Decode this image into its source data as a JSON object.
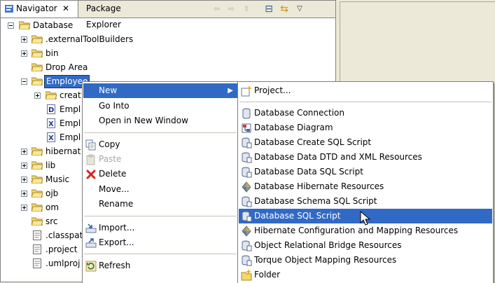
{
  "tabs": {
    "navigator": "Navigator",
    "navigator_close": "✕",
    "package_explorer": "Package Explorer"
  },
  "toolbar": {
    "back": "⇦",
    "forward": "⇨",
    "up": "⇧",
    "collapse": "⊟",
    "link": "⇆",
    "menu": "▽"
  },
  "tree": {
    "root": "Database",
    "items": [
      ".externalToolBuilders",
      "bin",
      "Drop Area",
      "Employee",
      "creat",
      "Empl",
      "Empl",
      "Empl",
      "hibernat",
      "lib",
      "Music",
      "ojb",
      "om",
      "src",
      ".classpat",
      ".project",
      ".umlproj"
    ]
  },
  "context_menu": {
    "new": "New",
    "go_into": "Go Into",
    "open_in_new_window": "Open in New Window",
    "copy": "Copy",
    "paste": "Paste",
    "delete": "Delete",
    "move": "Move...",
    "rename": "Rename",
    "import": "Import...",
    "export": "Export...",
    "refresh": "Refresh",
    "submenu_arrow": "▶"
  },
  "new_submenu": {
    "project": "Project...",
    "items": [
      "Database Connection",
      "Database Diagram",
      "Database Create SQL Script",
      "Database Data DTD and XML Resources",
      "Database Data SQL Script",
      "Database Hibernate Resources",
      "Database Schema SQL Script",
      "Database SQL Script",
      "Hibernate Configuration and Mapping Resources",
      "Object Relational Bridge Resources",
      "Torque Object Mapping Resources",
      "Folder"
    ],
    "highlighted": "Database SQL Script"
  },
  "colors": {
    "selection": "#316ac5",
    "folder": "#f5d76e",
    "delete_red": "#d8261c"
  }
}
